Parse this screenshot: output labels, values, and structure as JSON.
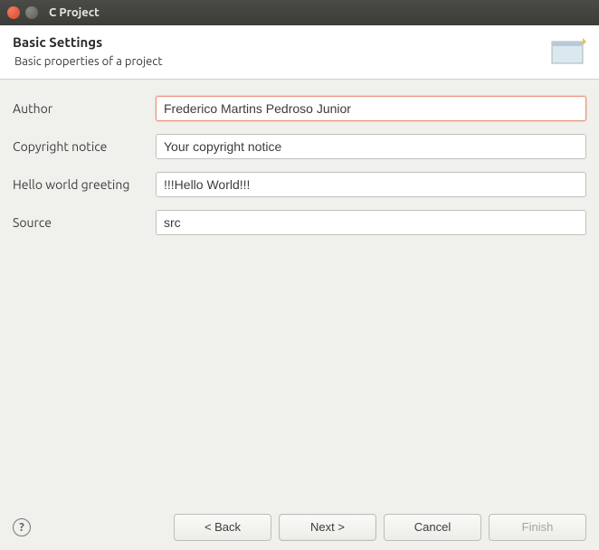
{
  "window": {
    "title": "C Project"
  },
  "header": {
    "title": "Basic Settings",
    "subtitle": "Basic properties of a project"
  },
  "form": {
    "author": {
      "label": "Author",
      "value": "Frederico Martins Pedroso Junior"
    },
    "copyright": {
      "label": "Copyright notice",
      "value": "Your copyright notice"
    },
    "greeting": {
      "label": "Hello world greeting",
      "value": "!!!Hello World!!!"
    },
    "source": {
      "label": "Source",
      "value": "src"
    }
  },
  "footer": {
    "help_tooltip": "?",
    "back_label": "< Back",
    "next_label": "Next >",
    "cancel_label": "Cancel",
    "finish_label": "Finish"
  }
}
